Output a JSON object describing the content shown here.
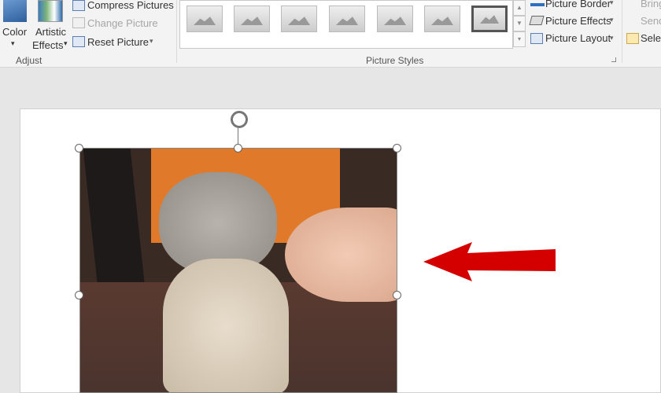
{
  "ribbon": {
    "adjust": {
      "color": "Color",
      "artistic": "Artistic",
      "effects": "Effects",
      "compress": "Compress Pictures",
      "change": "Change Picture",
      "reset": "Reset Picture",
      "group": "Adjust"
    },
    "styles": {
      "group": "Picture Styles",
      "border": "Picture Border",
      "effects": "Picture Effects",
      "layout": "Picture Layout"
    },
    "arrange": {
      "bring": "Bring",
      "send": "Send",
      "select": "Selec"
    }
  },
  "colors": {
    "arrow": "#d40000",
    "ribbon": "#f3f3f3"
  }
}
